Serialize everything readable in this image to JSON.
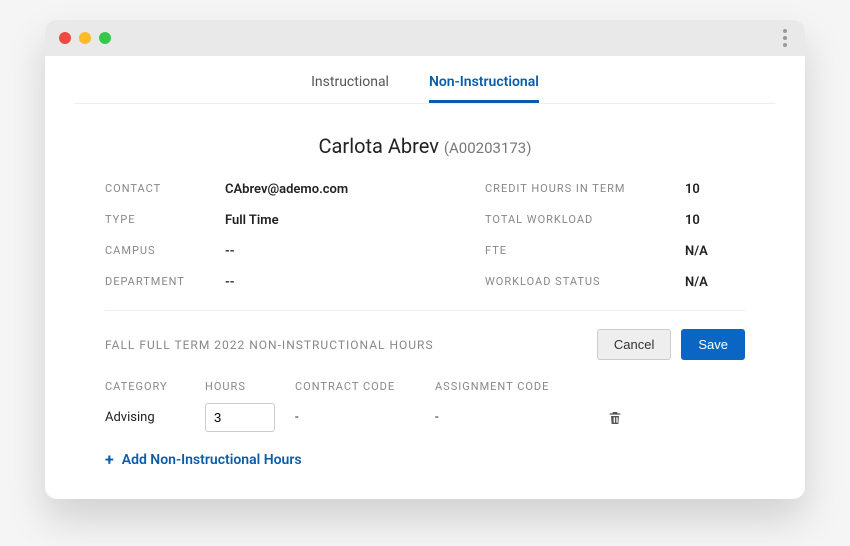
{
  "tabs": {
    "instructional": "Instructional",
    "non_instructional": "Non-Instructional"
  },
  "person": {
    "name": "Carlota Abrev",
    "id": "(A00203173)"
  },
  "info": {
    "labels": {
      "contact": "CONTACT",
      "type": "TYPE",
      "campus": "CAMPUS",
      "department": "DEPARTMENT",
      "credit_hours": "CREDIT HOURS IN TERM",
      "total_workload": "TOTAL WORKLOAD",
      "fte": "FTE",
      "workload_status": "WORKLOAD STATUS"
    },
    "values": {
      "contact": "CAbrev@ademo.com",
      "type": "Full Time",
      "campus": "--",
      "department": "--",
      "credit_hours": "10",
      "total_workload": "10",
      "fte": "N/A",
      "workload_status": "N/A"
    }
  },
  "section": {
    "title": "FALL FULL TERM 2022 NON-INSTRUCTIONAL HOURS",
    "cancel": "Cancel",
    "save": "Save"
  },
  "table": {
    "headers": {
      "category": "CATEGORY",
      "hours": "HOURS",
      "contract": "CONTRACT CODE",
      "assignment": "ASSIGNMENT CODE"
    },
    "row": {
      "category": "Advising",
      "hours": "3",
      "contract": "-",
      "assignment": "-"
    }
  },
  "add_label": "Add Non-Instructional Hours"
}
